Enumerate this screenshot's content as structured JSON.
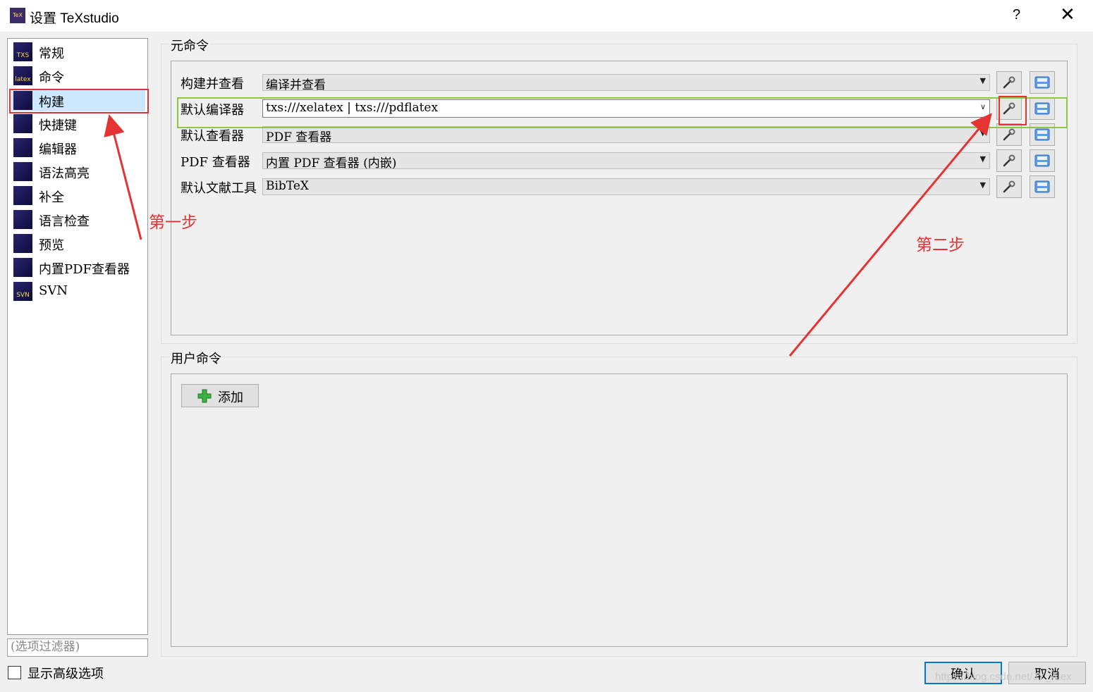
{
  "window": {
    "title": "设置 TeXstudio",
    "icon_text": "TeX",
    "help": "?",
    "close": "✕"
  },
  "sidebar": {
    "items": [
      {
        "label": "常规",
        "icon": "TXS"
      },
      {
        "label": "命令",
        "icon": "latex"
      },
      {
        "label": "构建",
        "icon": "build",
        "selected": true
      },
      {
        "label": "快捷键",
        "icon": "keyboard"
      },
      {
        "label": "编辑器",
        "icon": "cursor"
      },
      {
        "label": "语法高亮",
        "icon": "highlight"
      },
      {
        "label": "补全",
        "icon": "doc"
      },
      {
        "label": "语言检查",
        "icon": "cursor"
      },
      {
        "label": "预览",
        "icon": "page"
      },
      {
        "label": "内置PDF查看器",
        "icon": "page"
      },
      {
        "label": "SVN",
        "icon": "SVN"
      }
    ],
    "filter_placeholder": "(选项过滤器)",
    "show_advanced_label": "显示高级选项",
    "show_advanced_checked": false
  },
  "meta_commands": {
    "title": "元命令",
    "rows": [
      {
        "label": "构建并查看",
        "value": "编译并查看",
        "editable": false
      },
      {
        "label": "默认编译器",
        "value": "txs:///xelatex | txs:///pdflatex",
        "editable": true
      },
      {
        "label": "默认查看器",
        "value": "PDF 查看器",
        "editable": false
      },
      {
        "label": "PDF 查看器",
        "value": "内置 PDF 查看器 (内嵌)",
        "editable": false
      },
      {
        "label": "默认文献工具",
        "value": "BibTeX",
        "editable": false
      }
    ]
  },
  "user_commands": {
    "title": "用户命令",
    "add_label": "添加"
  },
  "footer": {
    "ok_label": "确认",
    "cancel_label": "取消"
  },
  "annotations": {
    "step1": "第一步",
    "step2": "第二步",
    "color": "#e53333",
    "highlight_color": "#8dc63f"
  },
  "watermark": "https://blog.csdn.net/JY_Alex"
}
